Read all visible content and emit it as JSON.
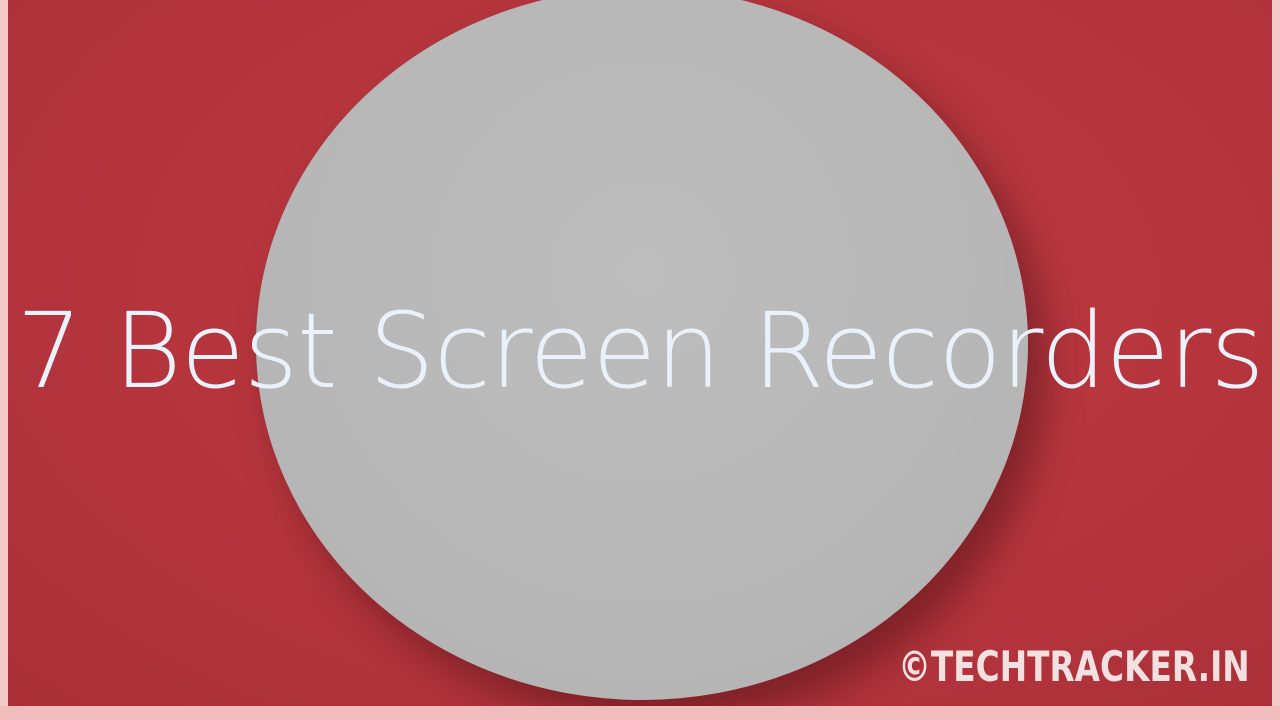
{
  "headline": "7 Best Screen Recorders",
  "watermark": "©TECHTRACKER.IN",
  "colors": {
    "background_red": "#b6353d",
    "circle_gray": "#b9b9b9",
    "text": "#e9f2fb"
  }
}
